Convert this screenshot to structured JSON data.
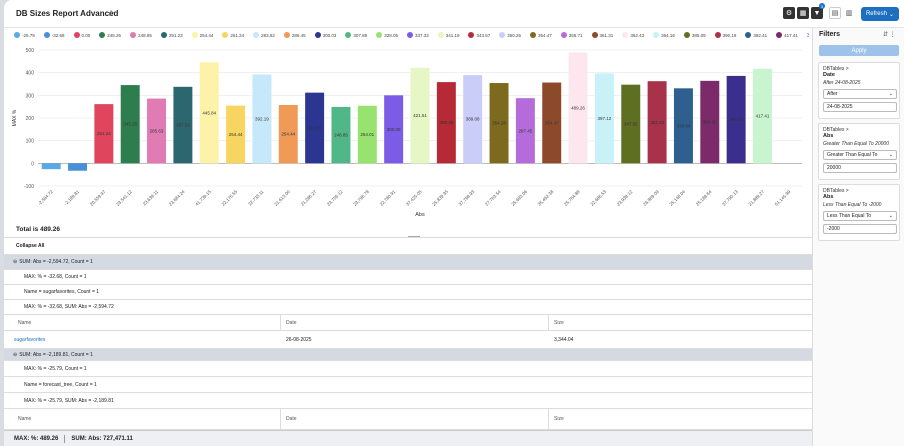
{
  "header": {
    "title": "DB Sizes Report Advanced",
    "filter_count": "3",
    "refresh_label": "Refresh"
  },
  "legend_more": "3 More",
  "chart_data": {
    "type": "bar",
    "xlabel": "Abs",
    "ylabel": "MAX %",
    "ylim": [
      -100,
      500
    ],
    "yticks": [
      -100,
      0,
      100,
      200,
      300,
      400,
      500
    ],
    "grid": true,
    "legend": "top",
    "categories": [
      "-2,594.72",
      "-2,189.81",
      "20,559.97",
      "23,541.12",
      "23,639.11",
      "23,684.24",
      "41,739.15",
      "22,175.55",
      "22,733.11",
      "21,613.00",
      "21,286.27",
      "23,756.12",
      "23,796.78",
      "22,780.91",
      "37,425.05",
      "25,839.35",
      "37,798.93",
      "27,763.54",
      "25,693.06",
      "35,462.38",
      "25,764.88",
      "22,686.53",
      "23,938.12",
      "26,869.09",
      "25,148.04",
      "25,188.64",
      "37,790.13",
      "21,889.27",
      "51,145.99"
    ],
    "values": [
      -25.79,
      -32.68,
      261.24,
      345.25,
      285.63,
      337.59,
      445.84,
      254.44,
      392.19,
      257.44,
      311.88,
      248.85,
      254.01,
      300.0,
      421.51,
      358.35,
      389.08,
      354.28,
      287.45,
      356.47,
      489.26,
      397.12,
      347.05,
      362.43,
      330.94,
      364.02,
      385.72,
      417.41,
      0
    ],
    "labels": [
      "",
      "",
      "261.24",
      "345.25",
      "285.63",
      "337.59",
      "445.84",
      "254.44",
      "392.19",
      "254.44",
      "311.88",
      "248.85",
      "254.01",
      "300.00",
      "421.51",
      "358.35",
      "389.08",
      "354.28",
      "287.45",
      "354.47",
      "489.26",
      "397.12",
      "347.05",
      "362.43",
      "330.94",
      "364.02",
      "385.72",
      "417.41",
      ""
    ],
    "colors": [
      "#5aa9e6",
      "#4a90d9",
      "#e0455d",
      "#2e7d4f",
      "#e07bb3",
      "#2c6770",
      "#fcf3a8",
      "#f7d560",
      "#c6e8fb",
      "#ef9a56",
      "#2b3592",
      "#52b788",
      "#98e36f",
      "#7c5ce6",
      "#e6f6c5",
      "#b52a36",
      "#c9cdf7",
      "#7d6a1e",
      "#b56bd9",
      "#8c4a2b",
      "#fde7ee",
      "#c8f2f7",
      "#5f6f22",
      "#a8324a",
      "#2f5f8f",
      "#7b2a6a",
      "#3b2e8c",
      "#c8f5cf",
      "#a9a9a9"
    ],
    "legend_entries": [
      "-25.79",
      "-32.68",
      "0.00",
      "245.25",
      "248.85",
      "251.23",
      "254.44",
      "261.24",
      "283.52",
      "286.45",
      "300.03",
      "307.89",
      "328.05",
      "337.33",
      "341.19",
      "343.57",
      "350.26",
      "354.47",
      "355.71",
      "361.31",
      "362.43",
      "364.16",
      "385.09",
      "390.19",
      "392.41",
      "417.41"
    ]
  },
  "total": "Total is 489.26",
  "collapse_all": "Collapse All",
  "grid": {
    "group1": "SUM: Abs = -2,594.72, Count = 1",
    "group1_sub1": "MAX: % = -32.68, Count = 1",
    "group1_sub2": "Name = sugarfavorites, Count = 1",
    "group1_sub3": "MAX: % = -32.68, SUM: Abs = -2,594.72",
    "col_name": "Name",
    "col_date": "Date",
    "col_size": "Size",
    "row_name": "sugarfavorites",
    "row_date": "26-08-2025",
    "row_size": "3,344.04",
    "group2": "SUM: Abs = -2,189.81, Count = 1",
    "group2_sub1": "MAX: % = -25.79, Count = 1",
    "group2_sub2": "Name = forecast_tree, Count = 1",
    "group2_sub3": "MAX: % = -25.79, SUM: Abs = -2,189.81"
  },
  "status": {
    "max": "MAX: %: 489.26",
    "sum": "SUM: Abs: 727,471.11"
  },
  "filters": {
    "title": "Filters",
    "apply": "Apply",
    "card1": {
      "path": "DBTables >",
      "field": "Date",
      "desc": "After 24-08-2025",
      "op": "After",
      "value": "24-08-2025"
    },
    "card2": {
      "path": "DBTables >",
      "field": "Abs",
      "desc": "Greater Than Equal To 20000",
      "op": "Greater Than Equal To",
      "value": "20000"
    },
    "card3": {
      "path": "DBTables >",
      "field": "Abs",
      "desc": "Less Than Equal To -2000",
      "op": "Less Than Equal To",
      "value": "-2000"
    }
  }
}
